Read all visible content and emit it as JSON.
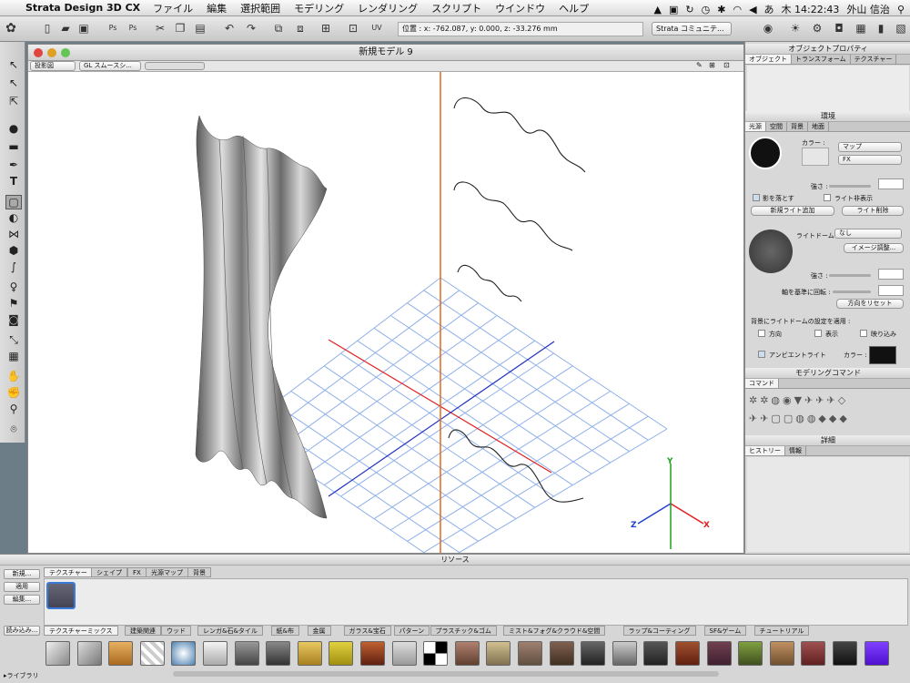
{
  "menubar": {
    "app": "Strata Design 3D CX",
    "items": [
      "ファイル",
      "編集",
      "選択範囲",
      "モデリング",
      "レンダリング",
      "スクリプト",
      "ウインドウ",
      "ヘルプ"
    ],
    "time": "木 14:22:43",
    "user": "外山 信治"
  },
  "toolbar": {
    "coord": "位置 : x: -762.087, y: 0.000, z: -33.276 mm",
    "community": "Strata コミュニテ..."
  },
  "viewport": {
    "title": "新規モデル 9",
    "view_select": "投影図",
    "render_select": "GL スムースシ..."
  },
  "axes": {
    "x": "X",
    "y": "Y",
    "z": "Z"
  },
  "objprop": {
    "title": "オブジェクトプロパティ",
    "tabs": [
      "オブジェクト",
      "トランスフォーム",
      "テクスチャー"
    ]
  },
  "env": {
    "title": "環境",
    "tabs": [
      "光源",
      "空間",
      "背景",
      "地面"
    ],
    "color_label": "カラー :",
    "map": "マップ",
    "fx": "FX",
    "strength": "強さ :",
    "cast_shadow": "影を落とす",
    "light_hidden": "ライト非表示",
    "add_light": "新規ライト追加",
    "delete_light": "ライト削除",
    "lightdome_label": "ライトドーム :",
    "lightdome_value": "なし",
    "image_adjust": "イメージ調整...",
    "strength2": "強さ :",
    "axis_rotate": "軸を基準に回転 :",
    "reset_dir": "方向をリセット",
    "apply_bg": "背景にライトドームの設定を適用 :",
    "opt_dir": "方向",
    "opt_show": "表示",
    "opt_reflect": "映り込み",
    "ambient": "アンビエントライト",
    "ambient_color": "カラー :"
  },
  "modeling": {
    "title": "モデリングコマンド",
    "tab": "コマンド"
  },
  "detail": {
    "title": "詳細",
    "tabs": [
      "ヒストリー",
      "情報"
    ]
  },
  "resources": {
    "title": "リソース",
    "new": "新規...",
    "apply": "適用",
    "edit": "編集...",
    "load": "読み込み...",
    "library": "▸ライブラリ",
    "tabs": [
      "テクスチャー",
      "シェイプ",
      "FX",
      "光源マップ",
      "背景"
    ],
    "categories": [
      "テクスチャーミックス",
      "建築関連",
      "ウッド",
      "レンガ&石&タイル",
      "紙&布",
      "金属",
      "ガラス&宝石",
      "パターン",
      "プラスチック&ゴム",
      "ミスト&フォグ&クラウド&空間",
      "ラップ&コーティング",
      "SF&ゲーム",
      "チュートリアル"
    ]
  },
  "colors": {
    "x_axis": "#e02020",
    "y_axis": "#20a020",
    "z_axis": "#2040d0",
    "grid": "#8fb0e8",
    "vertical": "#e06a20"
  }
}
